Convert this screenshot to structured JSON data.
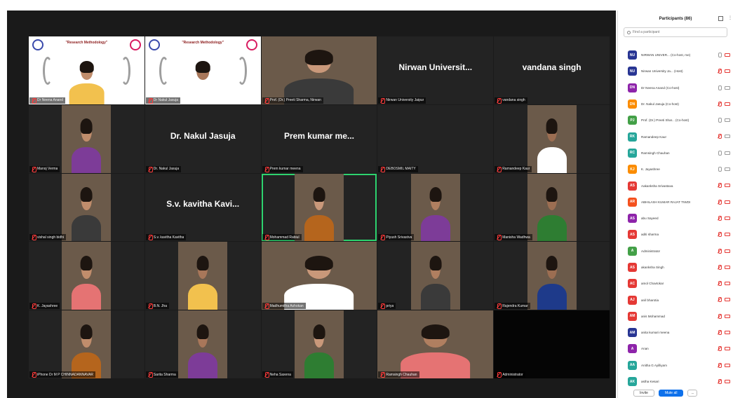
{
  "colors": {
    "active_speaker": "#2ed36f",
    "muted": "#e53935",
    "mute_all": "#0e71eb"
  },
  "gallery": [
    {
      "kind": "banner",
      "banner_title": "\"Research Methodology\"",
      "name": "Dr Neena Anand"
    },
    {
      "kind": "banner",
      "banner_title": "\"Research Methodology\"",
      "name": "Dr Nakul Jasuja"
    },
    {
      "kind": "video",
      "name": "Prof. (Dr.) Preeti Sharma, Nirwan"
    },
    {
      "kind": "name",
      "display": "Nirwan Universit...",
      "name": "Nirwan University Jaipur"
    },
    {
      "kind": "name",
      "display": "vandana singh",
      "name": "vandana singh"
    },
    {
      "kind": "video",
      "name": "Manoj  Verma"
    },
    {
      "kind": "name",
      "display": "Dr. Nakul Jasuja",
      "name": "Dr. Nakul Jasuja"
    },
    {
      "kind": "name",
      "display": "Prem kumar me...",
      "name": "Prem kumar meena"
    },
    {
      "kind": "empty",
      "name": "DEBOSMIL MAITY"
    },
    {
      "kind": "video",
      "name": "Ramandeep Kaur"
    },
    {
      "kind": "video",
      "name": "vishal singh bidhi"
    },
    {
      "kind": "name",
      "display": "S.v. kavitha Kavi...",
      "name": "S.v. kavitha Kavitha"
    },
    {
      "kind": "video",
      "name": "Mohammad Rabiul",
      "active": true
    },
    {
      "kind": "video",
      "name": "Piyush Srivastva"
    },
    {
      "kind": "video",
      "name": "Manisha Wadhwa"
    },
    {
      "kind": "video",
      "name": "K. Jayashree"
    },
    {
      "kind": "video",
      "name": "B.N. Jha"
    },
    {
      "kind": "video",
      "name": "Madhumitha Ashokan"
    },
    {
      "kind": "video",
      "name": "priya"
    },
    {
      "kind": "video",
      "name": "Rajendra Kumar"
    },
    {
      "kind": "video",
      "name": "iPhone Dr M P CHINNADANNAVAR"
    },
    {
      "kind": "video",
      "name": "Sarita Sharma"
    },
    {
      "kind": "video",
      "name": "Neha Saxena"
    },
    {
      "kind": "video",
      "name": "Ramsingh Chauhan"
    },
    {
      "kind": "empty",
      "name": "Administrator"
    }
  ],
  "panel": {
    "title": "Participants (86)",
    "search_placeholder": "Find a participant",
    "participants": [
      {
        "initials": "NU",
        "color": "#283593",
        "name": "NIRWAN UNIVER... (Co-host, me)",
        "mic": "on",
        "cam": "off"
      },
      {
        "initials": "NU",
        "color": "#283593",
        "name": "Nirwan University Ja... (Host)",
        "mic": "off",
        "cam": "off"
      },
      {
        "initials": "DN",
        "color": "#8e24aa",
        "name": "Dr Neena Anand (Co-host)",
        "mic": "on",
        "cam": "on"
      },
      {
        "initials": "DN",
        "color": "#fb8c00",
        "name": "Dr. Nakul Jasuja (Co-host)",
        "mic": "off",
        "cam": "off"
      },
      {
        "initials": "PJ",
        "color": "#43a047",
        "name": "Prof. (Dr.) Preeti Shar... (Co-host)",
        "mic": "on",
        "cam": "on"
      },
      {
        "initials": "RK",
        "color": "#26a69a",
        "name": "Ramandeep Kaur",
        "mic": "off",
        "cam": "on"
      },
      {
        "initials": "RC",
        "color": "#26a69a",
        "name": "Ramsingh Chauhan",
        "mic": "on",
        "cam": "on"
      },
      {
        "initials": "KJ",
        "color": "#fb8c00",
        "name": "K. Jayashree",
        "mic": "on",
        "cam": "on"
      },
      {
        "initials": "AS",
        "color": "#e53935",
        "name": "Aakanksha Srivastava",
        "mic": "off",
        "cam": "off"
      },
      {
        "initials": "AR",
        "color": "#f4511e",
        "name": "ABHILASH KUMAR RAJAT TIWDI",
        "mic": "off",
        "cam": "off"
      },
      {
        "initials": "AS",
        "color": "#8e24aa",
        "name": "abu Sayeed",
        "mic": "off",
        "cam": "off"
      },
      {
        "initials": "AS",
        "color": "#e53935",
        "name": "aditi sharma",
        "mic": "off",
        "cam": "off"
      },
      {
        "initials": "A",
        "color": "#43a047",
        "name": "Administrator",
        "mic": "off",
        "cam": "off"
      },
      {
        "initials": "AS",
        "color": "#e53935",
        "name": "akanksha Singh",
        "mic": "off",
        "cam": "off"
      },
      {
        "initials": "AC",
        "color": "#e53935",
        "name": "amol Chavtokar",
        "mic": "off",
        "cam": "off"
      },
      {
        "initials": "AJ",
        "color": "#e53935",
        "name": "anil bharotia",
        "mic": "off",
        "cam": "off"
      },
      {
        "initials": "AM",
        "color": "#e53935",
        "name": "anis Mohammad",
        "mic": "off",
        "cam": "off"
      },
      {
        "initials": "AM",
        "color": "#283593",
        "name": "anita kumari meena",
        "mic": "off",
        "cam": "off"
      },
      {
        "initials": "A",
        "color": "#8e24aa",
        "name": "Anan",
        "mic": "off",
        "cam": "off"
      },
      {
        "initials": "AA",
        "color": "#26a69a",
        "name": "Anitha G Ayilliyam",
        "mic": "off",
        "cam": "off"
      },
      {
        "initials": "AK",
        "color": "#26a69a",
        "name": "astha Kesari",
        "mic": "off",
        "cam": "off"
      }
    ],
    "footer": {
      "invite": "Invite",
      "mute_all": "Mute all",
      "more": "..."
    }
  }
}
